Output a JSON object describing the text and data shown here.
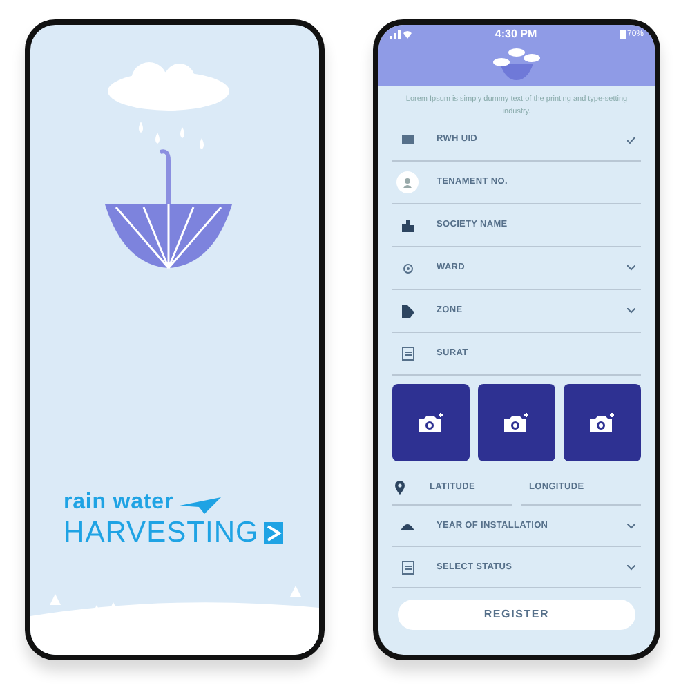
{
  "splash": {
    "tagline": "rain water",
    "title": "HARVESTING"
  },
  "form": {
    "status_bar": {
      "time": "4:30 PM",
      "battery": "70%"
    },
    "intro": "Lorem Ipsum is simply dummy text of the printing and type-setting industry.",
    "fields": [
      {
        "kind": "check",
        "label": "RWH UID"
      },
      {
        "kind": "person",
        "label": "TENAMENT NO."
      },
      {
        "kind": "text",
        "label": "SOCIETY NAME"
      },
      {
        "kind": "select",
        "label": "WARD"
      },
      {
        "kind": "select",
        "label": "ZONE"
      },
      {
        "kind": "text",
        "label": "SURAT"
      }
    ],
    "photo_buttons": [
      {
        "kind": "camera"
      },
      {
        "kind": "camera"
      },
      {
        "kind": "camera"
      }
    ],
    "location": {
      "latitude": "LATITUDE",
      "longitude": "LONGITUDE"
    },
    "selects": [
      {
        "label": "YEAR OF INSTALLATION"
      },
      {
        "label": "SELECT STATUS"
      }
    ],
    "submit": "REGISTER"
  }
}
